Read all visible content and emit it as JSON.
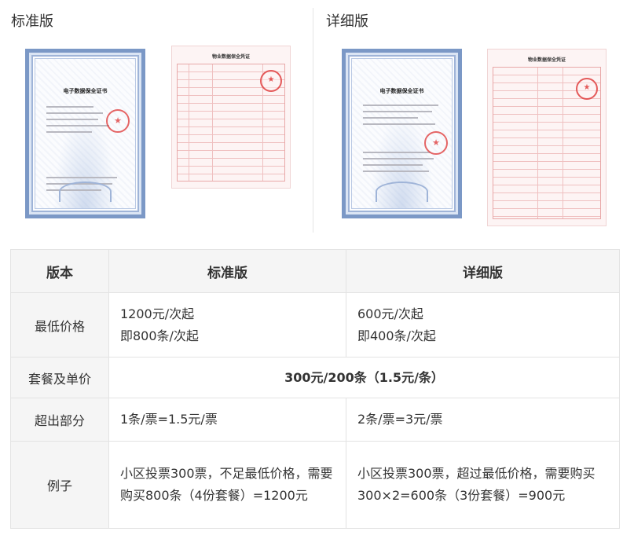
{
  "columns": {
    "standard_title": "标准版",
    "detailed_title": "详细版"
  },
  "images": {
    "standard_cert_title": "电子数据保全证书",
    "standard_voucher_title": "物业数据保全凭证",
    "detailed_cert_title": "电子数据保全证书",
    "detailed_voucher_title": "物业数据保全凭证"
  },
  "table": {
    "header": {
      "version": "版本",
      "standard": "标准版",
      "detailed": "详细版"
    },
    "rows": [
      {
        "label": "最低价格",
        "standard_line1": "1200元/次起",
        "standard_line2": "即800条/次起",
        "detailed_line1": "600元/次起",
        "detailed_line2": "即400条/次起"
      },
      {
        "label": "套餐及单价",
        "merged": "300元/200条（1.5元/条）"
      },
      {
        "label": "超出部分",
        "standard": "1条/票=1.5元/票",
        "detailed": "2条/票=3元/票"
      },
      {
        "label": "例子",
        "standard": "小区投票300票，不足最低价格，需要购买800条（4份套餐）=1200元",
        "detailed": "小区投票300票，超过最低价格，需要购买300×2=600条（3份套餐）=900元"
      }
    ]
  }
}
